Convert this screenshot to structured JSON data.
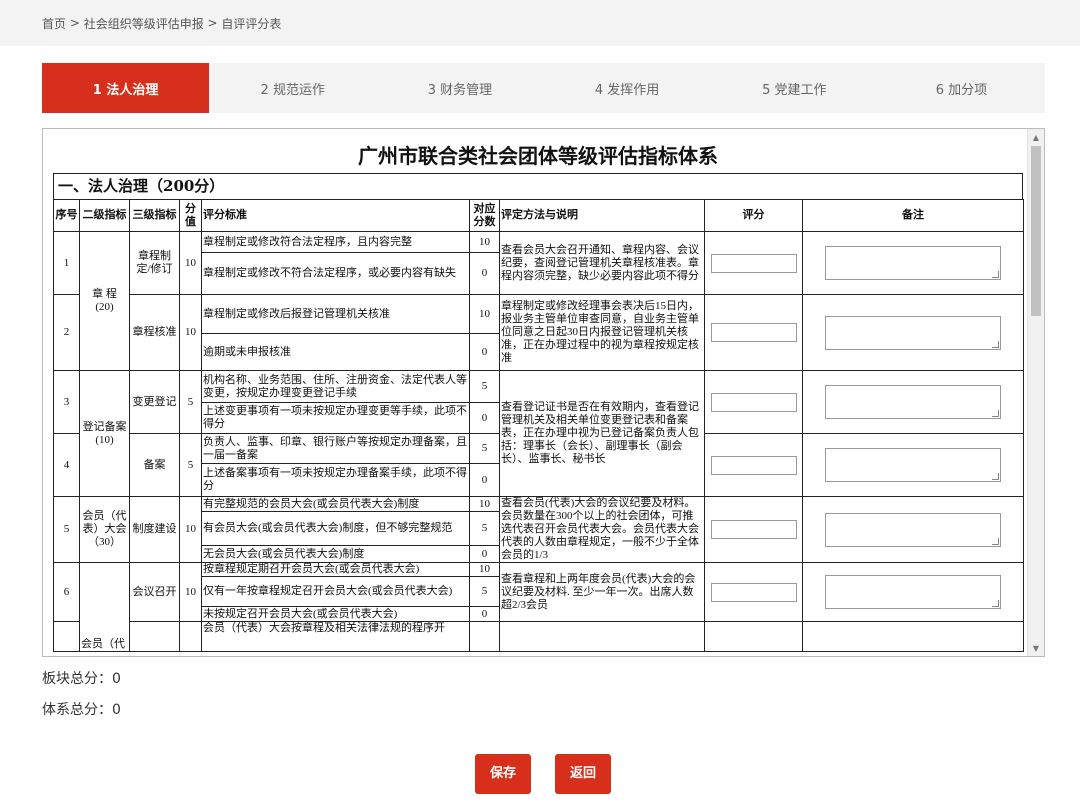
{
  "breadcrumb": {
    "home": "首页",
    "sep1": " > ",
    "level2": "社会组织等级评估申报",
    "sep2": " > ",
    "current": "自评评分表"
  },
  "tabs": [
    {
      "label": "1 法人治理",
      "active": true
    },
    {
      "label": "2 规范运作",
      "active": false
    },
    {
      "label": "3 财务管理",
      "active": false
    },
    {
      "label": "4 发挥作用",
      "active": false
    },
    {
      "label": "5 党建工作",
      "active": false
    },
    {
      "label": "6 加分项",
      "active": false
    }
  ],
  "doc": {
    "title": "广州市联合类社会团体等级评估指标体系",
    "section": "一、法人治理（200分）",
    "headers": {
      "no": "序号",
      "level2": "二级指标",
      "level3": "三级指标",
      "score": "分值",
      "criteria": "评分标准",
      "points": "对应分数",
      "method": "评定方法与说明",
      "rating": "评分",
      "remark": "备注"
    },
    "rows": {
      "r1": {
        "no": "1",
        "l3": "章程制定/修订",
        "score": "10",
        "a": "章程制定或修改符合法定程序，且内容完整",
        "a_pts": "10",
        "b": "章程制定或修改不符合法定程序，或必要内容有缺失",
        "b_pts": "0",
        "method": "查看会员大会召开通知、章程内容、会议纪要，查阅登记管理机关章程核准表。章程内容须完整，缺少必要内容此项不得分"
      },
      "l2_charter": "章 程",
      "l2_charter_pts": "(20)",
      "r2": {
        "no": "2",
        "l3": "章程核准",
        "score": "10",
        "a": "章程制定或修改后报登记管理机关核准",
        "a_pts": "10",
        "b": "逾期或未申报核准",
        "b_pts": "0",
        "method": "章程制定或修改经理事会表决后15日内，报业务主管单位审查同意，自业务主管单位同意之日起30日内报登记管理机关核准，正在办理过程中的视为章程按规定核准"
      },
      "l2_reg": "登记备案",
      "l2_reg_pts": "(10)",
      "r3": {
        "no": "3",
        "l3": "变更登记",
        "score": "5",
        "a": "机构名称、业务范围、住所、注册资金、法定代表人等变更，按规定办理变更登记手续",
        "a_pts": "5",
        "b": "上述变更事项有一项未按规定办理变更等手续，此项不得分",
        "b_pts": "0"
      },
      "method34": "查看登记证书是否在有效期内，查看登记管理机关及相关单位变更登记表和备案表，正在办理中视为已登记备案负责人包括：理事长（会长）、副理事长（副会长）、监事长、秘书长",
      "r4": {
        "no": "4",
        "l3": "备案",
        "score": "5",
        "a": "负责人、监事、印章、银行账户等按规定办理备案，且一届一备案",
        "a_pts": "5",
        "b": "上述备案事项有一项未按规定办理备案手续，此项不得分",
        "b_pts": "0"
      },
      "r5": {
        "no": "5",
        "l2": "会员（代表）大会",
        "l2_pts": "（30）",
        "l3": "制度建设",
        "score": "10",
        "a": "有完整规范的会员大会(或会员代表大会)制度",
        "a_pts": "10",
        "b": "有会员大会(或会员代表大会)制度，但不够完整规范",
        "b_pts": "5",
        "c": "无会员大会(或会员代表大会)制度",
        "c_pts": "0",
        "method": "查看会员(代表)大会的会议纪要及材料。会员数量在300个以上的社会团体，可推选代表召开会员代表大会。会员代表大会代表的人数由章程规定，一般不少于全体会员的1/3"
      },
      "r6": {
        "no": "6",
        "l3": "会议召开",
        "score": "10",
        "a": "按章程规定期召开会员大会(或会员代表大会)",
        "a_pts": "10",
        "b": "仅有一年按章程规定召开会员大会(或会员代表大会)",
        "b_pts": "5",
        "c": "未按规定召开会员大会(或会员代表大会)",
        "c_pts": "0",
        "method": "查看章程和上两年度会员(代表)大会的会议纪要及材料. 至少一年一次。出席人数超2/3会员"
      },
      "l2_next": "会员（代",
      "next_a": "会员（代表）大会按章程及相关法律法规的程序开"
    }
  },
  "totals": {
    "block_label": "板块总分：",
    "block_value": "0",
    "system_label": "体系总分：",
    "system_value": "0"
  },
  "buttons": {
    "save": "保存",
    "back": "返回"
  },
  "colors": {
    "accent": "#d6301c",
    "bar_bg": "#f3f3f3"
  }
}
